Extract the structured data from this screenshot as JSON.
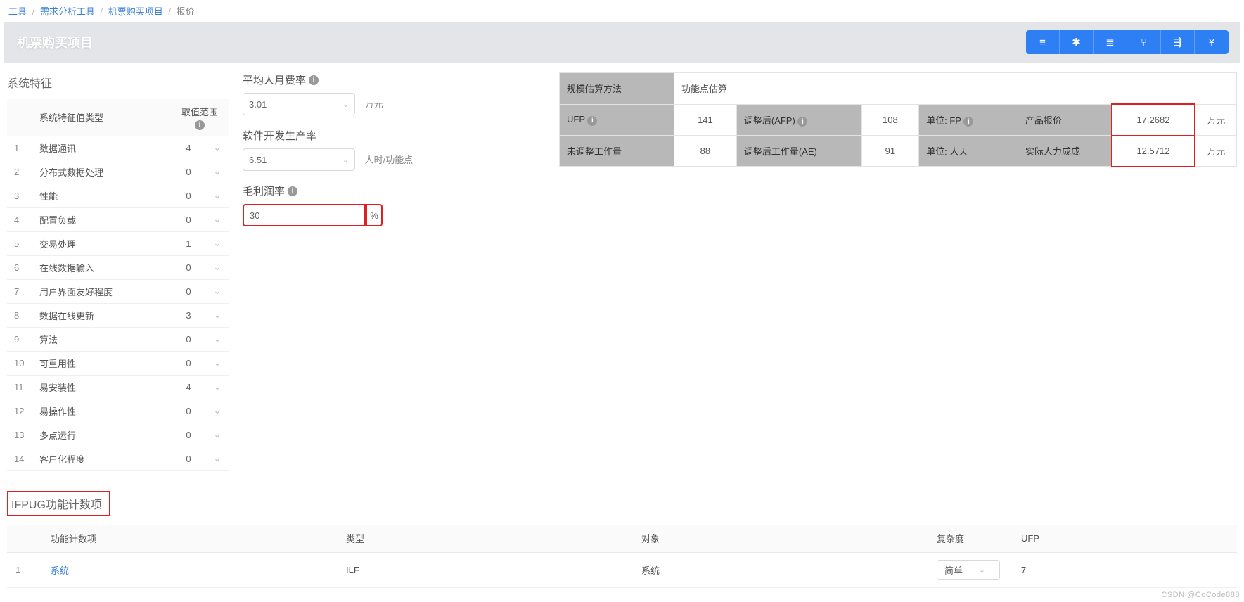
{
  "breadcrumb": {
    "items": [
      "工具",
      "需求分析工具",
      "机票购买项目"
    ],
    "current": "报价"
  },
  "header": {
    "title": "机票购买项目"
  },
  "toolbar_icons": [
    "list-icon",
    "gear-icon",
    "sliders-icon",
    "share-icon",
    "indent-icon",
    "currency-icon"
  ],
  "toolbar_glyphs": [
    "≡",
    "✱",
    "≣",
    "⑂",
    "⇶",
    "¥"
  ],
  "characteristics": {
    "title": "系统特征",
    "headers": {
      "type": "系统特征值类型",
      "range": "取值范围"
    },
    "rows": [
      {
        "idx": "1",
        "name": "数据通讯",
        "value": "4"
      },
      {
        "idx": "2",
        "name": "分布式数据处理",
        "value": "0"
      },
      {
        "idx": "3",
        "name": "性能",
        "value": "0"
      },
      {
        "idx": "4",
        "name": "配置负载",
        "value": "0"
      },
      {
        "idx": "5",
        "name": "交易处理",
        "value": "1"
      },
      {
        "idx": "6",
        "name": "在线数据输入",
        "value": "0"
      },
      {
        "idx": "7",
        "name": "用户界面友好程度",
        "value": "0"
      },
      {
        "idx": "8",
        "name": "数据在线更新",
        "value": "3"
      },
      {
        "idx": "9",
        "name": "算法",
        "value": "0"
      },
      {
        "idx": "10",
        "name": "可重用性",
        "value": "0"
      },
      {
        "idx": "11",
        "name": "易安装性",
        "value": "4"
      },
      {
        "idx": "12",
        "name": "易操作性",
        "value": "0"
      },
      {
        "idx": "13",
        "name": "多点运行",
        "value": "0"
      },
      {
        "idx": "14",
        "name": "客户化程度",
        "value": "0"
      }
    ]
  },
  "params": {
    "avg_cost": {
      "label": "平均人月费率",
      "value": "3.01",
      "unit": "万元"
    },
    "productivity": {
      "label": "软件开发生产率",
      "value": "6.51",
      "unit": "人时/功能点"
    },
    "margin": {
      "label": "毛利润率",
      "value": "30",
      "unit": "%"
    }
  },
  "estimation": {
    "method_label": "规模估算方法",
    "method_value": "功能点估算",
    "ufp_label": "UFP",
    "ufp_value": "141",
    "afp_label": "调整后(AFP)",
    "afp_value": "108",
    "unit_fp_label": "单位: FP",
    "quote_label": "产品报价",
    "quote_value": "17.2682",
    "quote_unit": "万元",
    "unadj_label": "未调整工作量",
    "unadj_value": "88",
    "ae_label": "调整后工作量(AE)",
    "ae_value": "91",
    "unit_pd_label": "单位: 人天",
    "cost_label": "实际人力成成",
    "cost_value": "12.5712",
    "cost_unit": "万元"
  },
  "ifpug": {
    "title": "IFPUG功能计数项",
    "headers": {
      "item": "功能计数项",
      "type": "类型",
      "object": "对象",
      "complexity": "复杂度",
      "ufp": "UFP"
    },
    "rows": [
      {
        "idx": "1",
        "item": "系统",
        "type": "ILF",
        "object": "系统",
        "complexity": "简单",
        "ufp": "7"
      }
    ]
  },
  "watermark": "CSDN @CoCode888"
}
